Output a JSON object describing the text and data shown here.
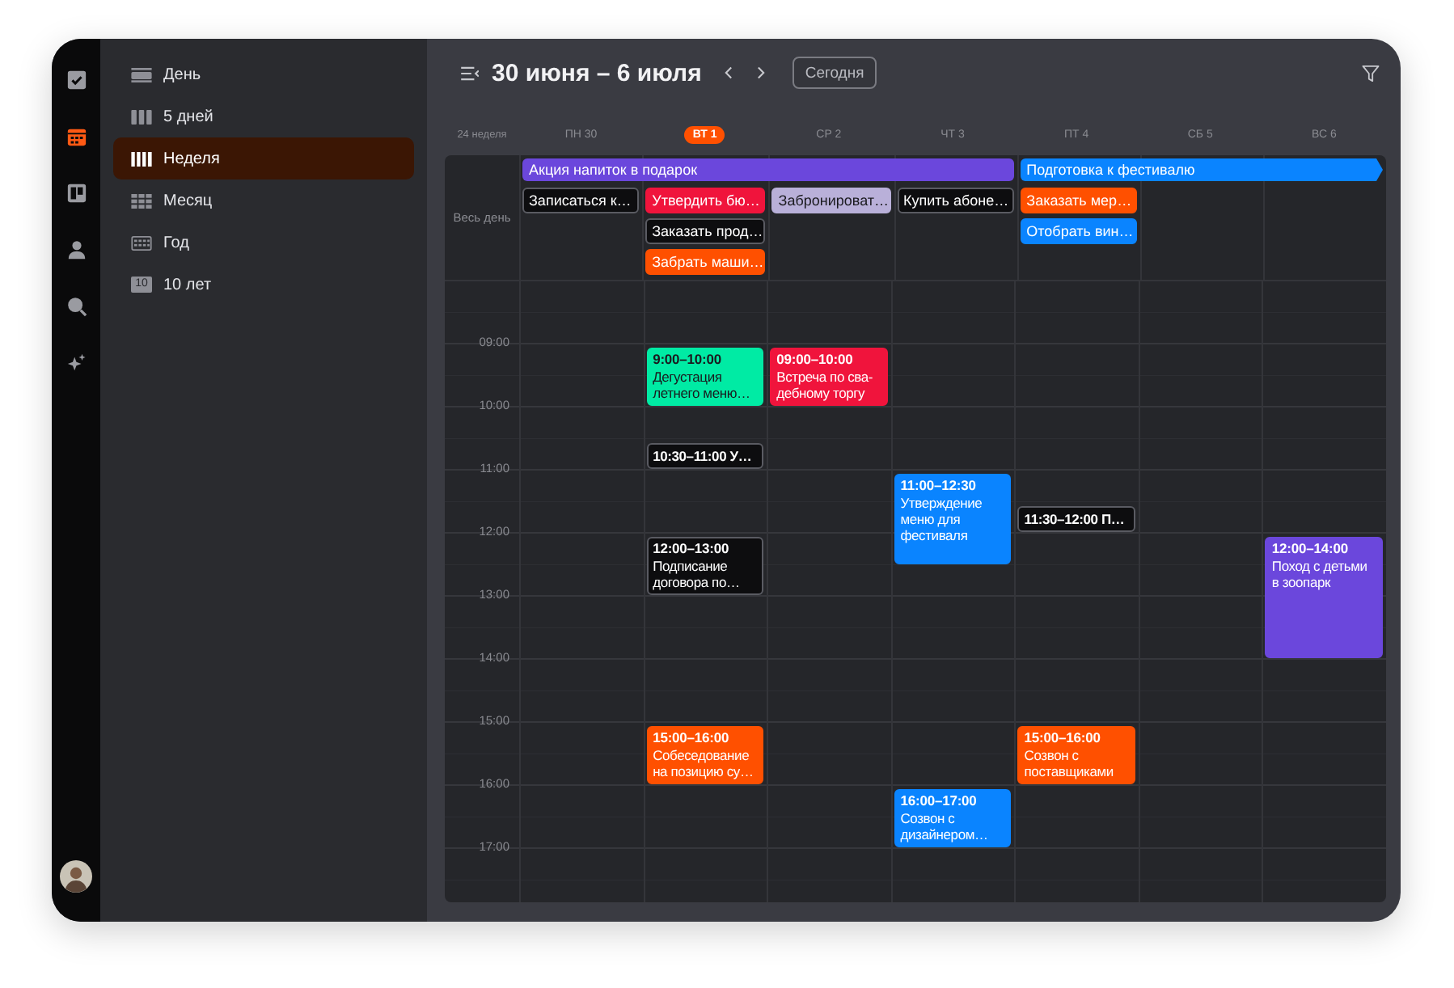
{
  "rail": [
    {
      "kind": "tasks",
      "selected": false
    },
    {
      "kind": "calendar",
      "selected": true
    },
    {
      "kind": "board",
      "selected": false
    },
    {
      "kind": "contacts",
      "selected": false
    },
    {
      "kind": "search",
      "selected": false
    },
    {
      "kind": "magic",
      "selected": false
    }
  ],
  "views": [
    {
      "kind": "day",
      "label": "День",
      "selected": false
    },
    {
      "kind": "five",
      "label": "5 дней",
      "selected": false
    },
    {
      "kind": "week",
      "label": "Неделя",
      "selected": true
    },
    {
      "kind": "month",
      "label": "Месяц",
      "selected": false
    },
    {
      "kind": "year",
      "label": "Год",
      "selected": false
    },
    {
      "kind": "decade",
      "icon_text": "10",
      "label": "10 лет",
      "selected": false
    }
  ],
  "header": {
    "title": "30 июня – 6 июля",
    "today_button": "Сегодня"
  },
  "week_label": "24 неделя",
  "all_day_label": "Весь день",
  "time_labels": [
    "09:00",
    "10:00",
    "11:00",
    "12:00",
    "13:00",
    "14:00",
    "15:00",
    "16:00",
    "17:00"
  ],
  "days": [
    {
      "label": "ПН 30",
      "today": false,
      "banner": {
        "title": "Акция напиток в подарок",
        "color": "#6b47dc",
        "continues": false
      },
      "chips": [
        {
          "title": "Записаться к…",
          "color": "#0d0d0f"
        }
      ]
    },
    {
      "label": "ВТ 1",
      "today": true,
      "bar_continues": true,
      "chips": [
        {
          "title": "Утвердить бю…",
          "color": "#f0143c"
        },
        {
          "title": "Заказать прод…",
          "color": "#0d0d0f"
        },
        {
          "title": "Забрать маши…",
          "color": "#ff5000"
        }
      ],
      "events": [
        {
          "kind": "block",
          "time": "9:00–10:00",
          "title": "Дегустация\nлетнего меню…",
          "color": "#00eba4"
        },
        {
          "kind": "compact",
          "text": "10:30–11:00 У…",
          "color": "#0d0d0f"
        },
        {
          "kind": "block",
          "time": "12:00–13:00",
          "title": "Подписание\nдоговора по…",
          "color": "#0d0d0f"
        },
        {
          "kind": "block",
          "time": "15:00–16:00",
          "title": "Собеседование\nна позицию су…",
          "color": "#ff5000"
        }
      ]
    },
    {
      "label": "СР 2",
      "today": false,
      "bar_continues": true,
      "chips": [
        {
          "title": "Забронироват…",
          "color": "#b9b0d9"
        }
      ],
      "events": [
        {
          "kind": "block",
          "time": "09:00–10:00",
          "title": "Встреча по сва-\nдебному торгу",
          "color": "#f0143c"
        }
      ]
    },
    {
      "label": "ЧТ 3",
      "today": false,
      "bar_continues": true,
      "chips": [
        {
          "title": "Купить абоне…",
          "color": "#0d0d0f"
        }
      ],
      "events": [
        {
          "kind": "block",
          "time": "11:00–12:30",
          "title": "Утверждение\nменю для\nфестиваля",
          "color": "#0a84ff"
        },
        {
          "kind": "block",
          "time": "16:00–17:00",
          "title": "Созвон с\nдизайнером…",
          "color": "#0a84ff"
        }
      ]
    },
    {
      "label": "ПТ 4",
      "today": false,
      "banner": {
        "title": "Подготовка к фестивалю",
        "color": "#0a84ff",
        "continues": true
      },
      "chips": [
        {
          "title": "Заказать мер…",
          "color": "#ff5000"
        },
        {
          "title": "Отобрать вин…",
          "color": "#0a84ff"
        }
      ],
      "events": [
        {
          "kind": "compact",
          "text": "11:30–12:00 П…",
          "color": "#0d0d0f"
        },
        {
          "kind": "block",
          "time": "15:00–16:00",
          "title": "Созвон с\nпоставщиками",
          "color": "#ff5000"
        }
      ]
    },
    {
      "label": "СБ 5",
      "today": false,
      "bar_continues": true
    },
    {
      "label": "ВС 6",
      "today": false,
      "bar_continues": true,
      "events": [
        {
          "kind": "block",
          "time": "12:00–14:00",
          "title": "Поход с детьми\nв зоопарк",
          "color": "#6b47dc"
        }
      ]
    }
  ]
}
